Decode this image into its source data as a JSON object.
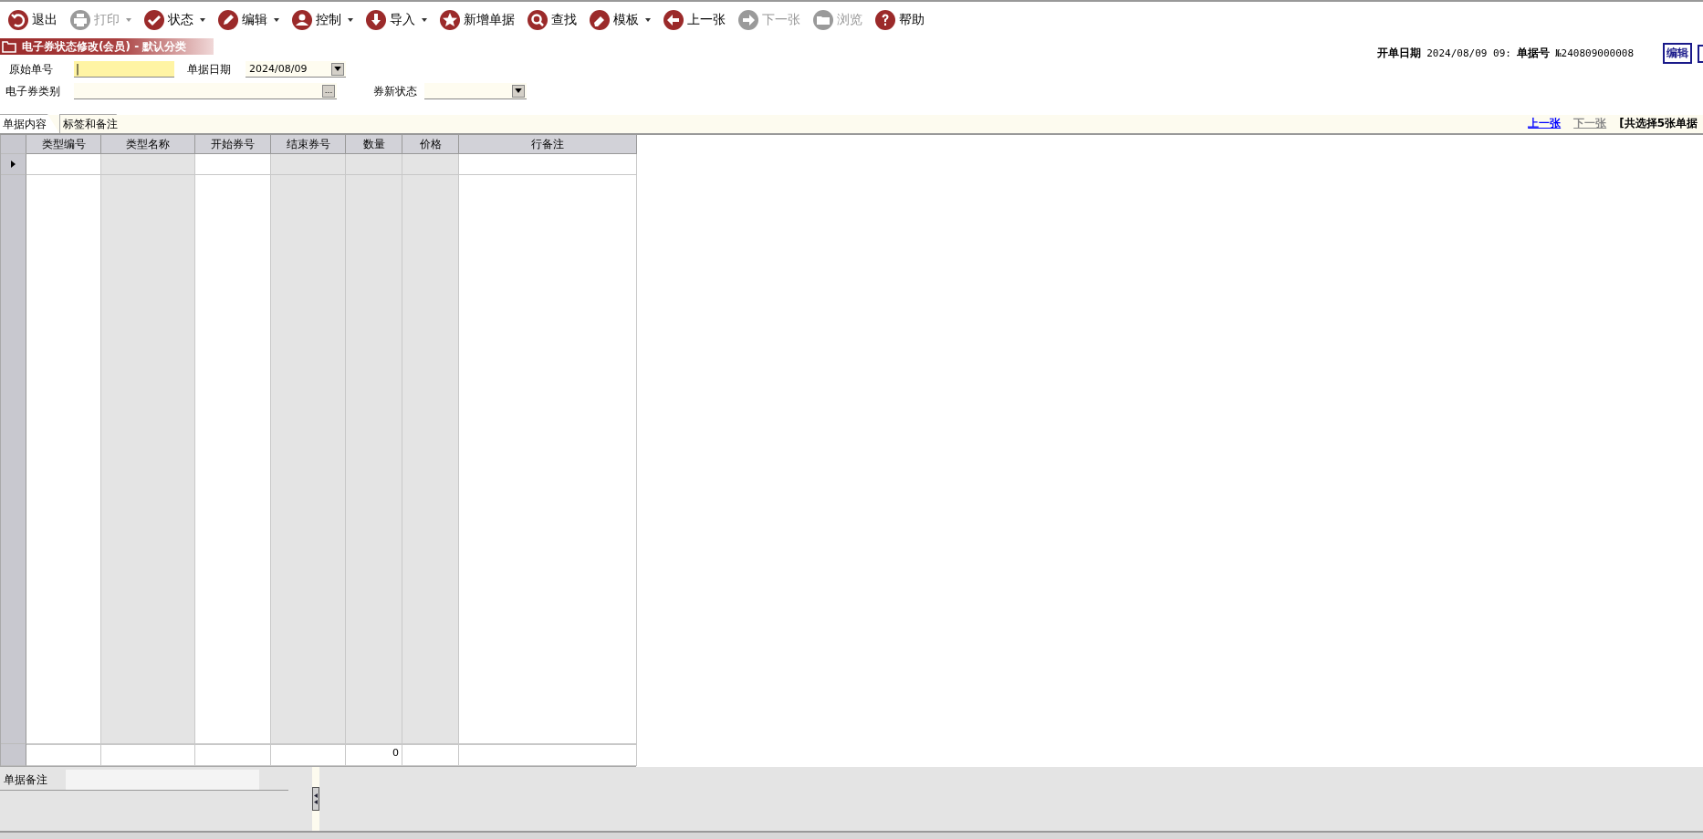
{
  "toolbar": [
    {
      "label": "退出",
      "kind": "undo",
      "disabled": false,
      "dropdown": false
    },
    {
      "label": "打印",
      "kind": "print",
      "disabled": true,
      "dropdown": true
    },
    {
      "label": "状态",
      "kind": "check",
      "disabled": false,
      "dropdown": true
    },
    {
      "label": "编辑",
      "kind": "pen",
      "disabled": false,
      "dropdown": true
    },
    {
      "label": "控制",
      "kind": "person",
      "disabled": false,
      "dropdown": true
    },
    {
      "label": "导入",
      "kind": "down",
      "disabled": false,
      "dropdown": true
    },
    {
      "label": "新增单据",
      "kind": "star",
      "disabled": false,
      "dropdown": false
    },
    {
      "label": "查找",
      "kind": "search",
      "disabled": false,
      "dropdown": false
    },
    {
      "label": "模板",
      "kind": "eraser",
      "disabled": false,
      "dropdown": true
    },
    {
      "label": "上一张",
      "kind": "left",
      "disabled": false,
      "dropdown": false
    },
    {
      "label": "下一张",
      "kind": "right",
      "disabled": true,
      "dropdown": false
    },
    {
      "label": "浏览",
      "kind": "folder",
      "disabled": true,
      "dropdown": false
    },
    {
      "label": "帮助",
      "kind": "help",
      "disabled": false,
      "dropdown": false
    }
  ],
  "title": "电子券状态修改(会员) - 默认分类",
  "header": {
    "date_label": "开单日期",
    "date_value": "2024/08/09 09:",
    "number_label": "单据号",
    "number_value": "№240809000008",
    "edit_button": "编辑"
  },
  "form": {
    "original_no": {
      "label": "原始单号",
      "value": "|"
    },
    "doc_date": {
      "label": "单据日期",
      "value": "2024/08/09"
    },
    "coupon_type": {
      "label": "电子券类别",
      "button": "..."
    },
    "new_state": {
      "label": "券新状态"
    }
  },
  "tabs": [
    {
      "label": "单据内容",
      "selected": true
    },
    {
      "label": "标签和备注",
      "selected": false
    }
  ],
  "nav": {
    "prev": "上一张",
    "next": "下一张",
    "summary": "[共选择5张单据"
  },
  "table": {
    "columns": [
      {
        "label": "类型编号",
        "shaded": false
      },
      {
        "label": "类型名称",
        "shaded": true
      },
      {
        "label": "开始券号",
        "shaded": false
      },
      {
        "label": "结束券号",
        "shaded": true
      },
      {
        "label": "数量",
        "shaded": true
      },
      {
        "label": "价格",
        "shaded": true
      },
      {
        "label": "行备注",
        "shaded": false
      }
    ],
    "quantity_total": "0"
  },
  "remarks": {
    "label": "单据备注"
  }
}
